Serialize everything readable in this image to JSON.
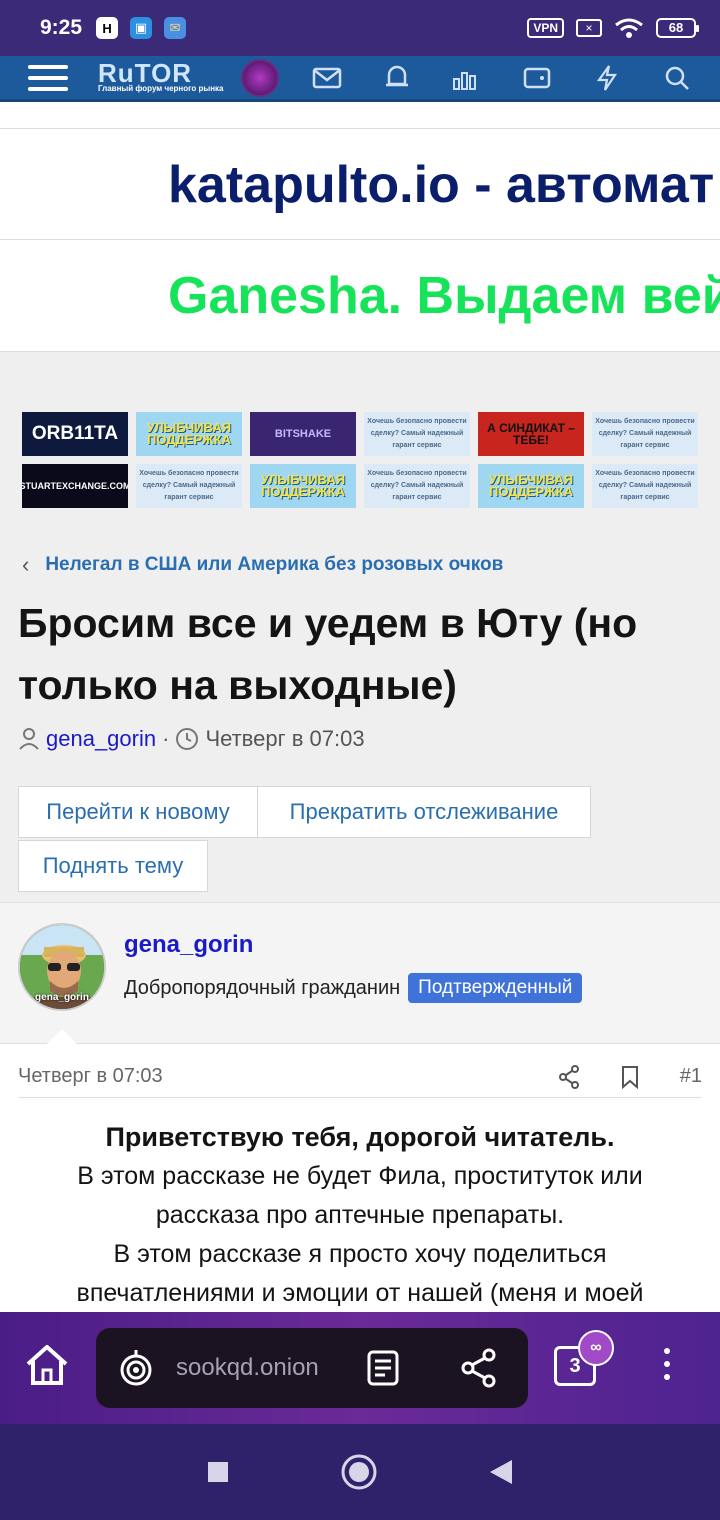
{
  "status_bar": {
    "time": "9:25",
    "vpn": "VPN",
    "battery": "68"
  },
  "forum_nav": {
    "logo_main": "RuTOR",
    "logo_sub": "Главный форум черного рынка",
    "icons": [
      "mail-icon",
      "bell-icon",
      "chart-icon",
      "wallet-icon",
      "bolt-icon",
      "search-icon"
    ]
  },
  "banners": {
    "text1": "katapulto.io - автомат",
    "text2": "Ganesha. Выдаем вей"
  },
  "ads": [
    {
      "label": "ORB11TA",
      "style": "dark"
    },
    {
      "label": "УЛЫБЧИВАЯ ПОДДЕРЖКА",
      "style": "yellow"
    },
    {
      "label": "BITSHAKE",
      "style": "purple"
    },
    {
      "label": "Хочешь безопасно провести сделку? Самый надежный гарант сервис",
      "style": "light"
    },
    {
      "label": "А СИНДИКАТ – ТЕБЕ!",
      "style": "red"
    },
    {
      "label": "Хочешь безопасно провести сделку? Самый надежный гарант сервис",
      "style": "light"
    },
    {
      "label": "STUARTEXCHANGE.COM",
      "style": "black"
    },
    {
      "label": "Хочешь безопасно провести сделку? Самый надежный гарант сервис",
      "style": "light"
    },
    {
      "label": "УЛЫБЧИВАЯ ПОДДЕРЖКА",
      "style": "yellow"
    },
    {
      "label": "Хочешь безопасно провести сделку? Самый надежный гарант сервис",
      "style": "light"
    },
    {
      "label": "УЛЫБЧИВАЯ ПОДДЕРЖКА",
      "style": "yellow"
    },
    {
      "label": "Хочешь безопасно провести сделку? Самый надежный гарант сервис",
      "style": "light"
    }
  ],
  "breadcrumb": "Нелегал в США или Америка без розовых очков",
  "thread": {
    "title": "Бросим все и уедем в Юту (но только на выходные)",
    "author": "gena_gorin",
    "separator": "·",
    "date": "Четверг в 07:03"
  },
  "actions": {
    "new": "Перейти к новому",
    "unwatch": "Прекратить отслеживание",
    "bump": "Поднять тему"
  },
  "post": {
    "username": "gena_gorin",
    "avatar_label": "gena_gorin",
    "user_title": "Добропорядочный гражданин",
    "badge": "Подтвержденный",
    "date": "Четверг в 07:03",
    "number": "#1",
    "greeting": "Приветствую тебя, дорогой читатель.",
    "lines": [
      "В этом рассказе не будет Фила, проституток или",
      "рассказа про аптечные препараты.",
      "В этом рассказе я просто хочу поделиться",
      "впечатлениями и эмоции от нашей (меня и моей"
    ]
  },
  "browser": {
    "url": "sookqd.onion",
    "tab_count": "3"
  },
  "colors": {
    "status_bar": "#3a2a78",
    "forum_nav": "#1d5a9c",
    "link": "#2a6eb0",
    "verified_badge": "#3f73d9",
    "banner1": "#0b1e6b",
    "banner2": "#17e35a"
  }
}
